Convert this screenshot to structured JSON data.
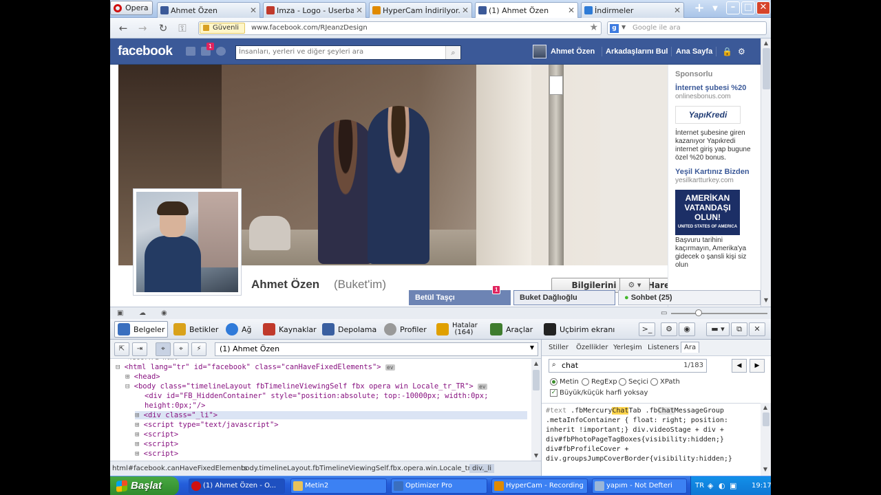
{
  "browser": {
    "opera_label": "Opera",
    "tabs": [
      {
        "label": "Ahmet Özen",
        "favicon_color": "#3b5998"
      },
      {
        "label": "Imza - Logo - Userbar -...",
        "favicon_color": "#c0392b"
      },
      {
        "label": "HyperCam İndirilyor......",
        "favicon_color": "#e08a00"
      },
      {
        "label": "(1) Ahmet Özen",
        "favicon_color": "#3b5998"
      },
      {
        "label": "İndirmeler",
        "favicon_color": "#2e7bd6"
      }
    ],
    "new_tab": "+",
    "secure_label": "Güvenli",
    "url": "www.facebook.com/RJeanzDesign",
    "search_placeholder": "Google ile ara",
    "search_engine_letter": "g"
  },
  "facebook": {
    "logo": "facebook",
    "notification_count": "1",
    "search_placeholder": "İnsanları, yerleri ve diğer şeyleri ara",
    "nav": {
      "user_name": "Ahmet Özen",
      "find_friends": "Arkadaşlarını Bul",
      "home": "Ana Sayfa"
    },
    "profile": {
      "name": "Ahmet Özen",
      "nickname": "(Buket'im)",
      "update_info_button": "Bilgilerini Güncelle",
      "activity_log_button": "Hareketler Dökümü"
    },
    "sidebar": {
      "sponsored": "Sponsorlu",
      "ads": [
        {
          "title": "İnternet şubesi %20",
          "url": "onlinesbonus.com",
          "logo_text": "YapıKredi",
          "text": "İnternet şubesine giren kazanıyor Yapıkredi internet giriş yap bugune özel %20 bonus."
        },
        {
          "title": "Yeşil Kartınız Bizden",
          "url": "yesilkartturkey.com",
          "image_text": "AMERİKAN VATANDAŞI OLUN!",
          "image_subtext": "UNITED STATES OF AMERICA",
          "text": "Başvuru tarihini kaçırmayın, Amerika'ya gidecek o şansli kişi siz olun"
        }
      ]
    },
    "chat": {
      "tab1": "Betül Taşçı",
      "tab1_badge": "1",
      "tab2": "Buket Dağlıoğlu",
      "sohbet": "Sohbet (25)"
    }
  },
  "dragonfly": {
    "tabs": [
      {
        "label": "Belgeler",
        "color": "#3a6fbf"
      },
      {
        "label": "Betikler",
        "color": "#d9a21b"
      },
      {
        "label": "Ağ",
        "color": "#2f7ad9"
      },
      {
        "label": "Kaynaklar",
        "color": "#c0392b"
      },
      {
        "label": "Depolama",
        "color": "#3a5fa0"
      },
      {
        "label": "Profiler",
        "color": "#999999"
      },
      {
        "label": "Hatalar (164)",
        "color": "#e0a000"
      },
      {
        "label": "Araçlar",
        "color": "#3f7c2e"
      },
      {
        "label": "Uçbirim ekranı",
        "color": "#222222"
      }
    ],
    "context_select": "(1) Ahmet Özen",
    "dom": {
      "line0": "<html lang=\"tr\" id=\"facebook\" class=\"canHaveFixedElements\">",
      "line1": "<head>",
      "line2": "<body class=\"timelineLayout fbTimelineViewingSelf fbx opera win Locale_tr_TR\">",
      "line3": "<div id=\"FB_HiddenContainer\" style=\"position:absolute; top:-10000px; width:0px;",
      "line4": "height:0px;\"/>",
      "line5": "<div class=\"_li\">",
      "line6": "<script type=\"text/javascript\">",
      "line7": "<script>",
      "line8": "<script>",
      "line9": "<script>",
      "ev": "ev"
    },
    "breadcrumbs": [
      "html#facebook.canHaveFixedElements",
      "body.timelineLayout.fbTimelineViewingSelf.fbx.opera.win.Locale_tr_TR",
      "div._li"
    ],
    "side_tabs": [
      "Stiller",
      "Özellikler",
      "Yerleşim",
      "Listeners",
      "Ara"
    ],
    "search": {
      "query": "chat",
      "count": "1/183",
      "options": [
        "Metin",
        "RegExp",
        "Seçici",
        "XPath"
      ],
      "case_label": "Büyük/küçük harfi yoksay"
    },
    "css_text": {
      "l1a": "#text",
      "l1b": "   .fbMercury",
      "l1hl": "Chat",
      "l1c": "Tab .fb",
      "l1hl2": "Chat",
      "l1d": "MessageGroup",
      "l2": ".metaInfoContainer { float: right; position:",
      "l3": "inherit !important;} div.videoStage + div +",
      "l4": "div#fbPhotoPageTagBoxes{visibility:hidden;}",
      "l5": "div#fbProfileCover +",
      "l6": "div.groupsJumpCoverBorder{visibility:hidden;}"
    }
  },
  "taskbar": {
    "start": "Başlat",
    "items": [
      {
        "label": "(1) Ahmet Özen - O...",
        "color": "#d01010"
      },
      {
        "label": "Metin2",
        "color": "#e8c25a"
      },
      {
        "label": "Optimizer Pro",
        "color": "#3a6fbf"
      },
      {
        "label": "HyperCam - Recording",
        "color": "#e08a00"
      },
      {
        "label": "yapım - Not Defteri",
        "color": "#9ab6d8"
      }
    ],
    "lang": "TR",
    "clock": "19:17"
  }
}
